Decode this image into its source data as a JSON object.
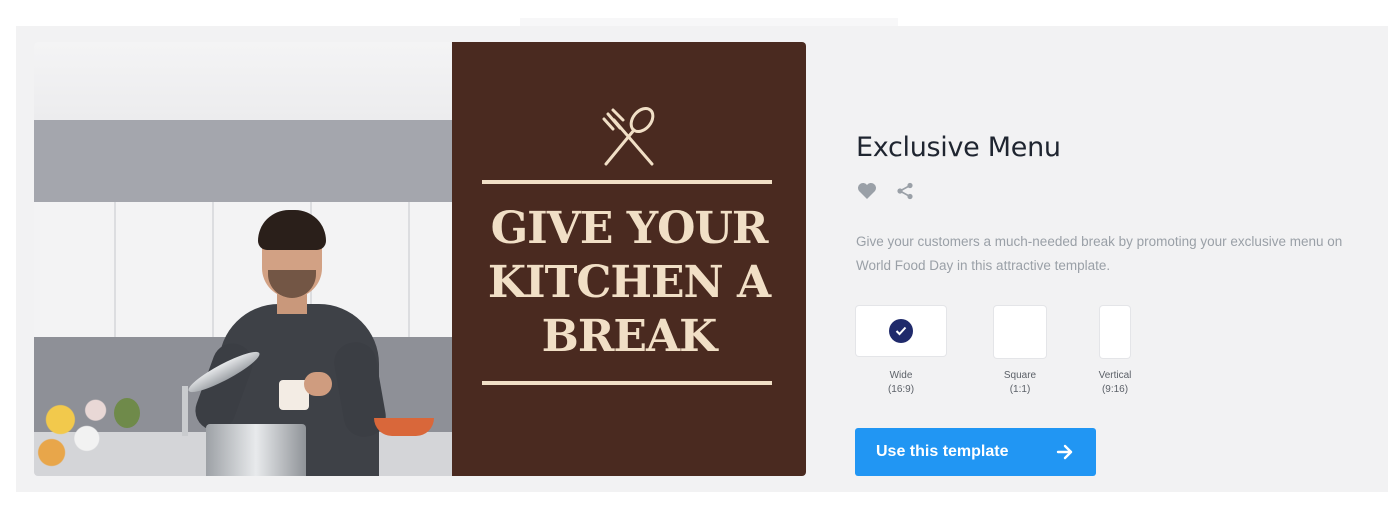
{
  "template": {
    "title": "Exclusive Menu",
    "description": "Give your customers a much-needed break by promoting your exclusive menu on World Food Day in this attractive template.",
    "actions": {
      "like_icon": "heart-icon",
      "share_icon": "share-icon"
    },
    "preview": {
      "headline": "GIVE YOUR KITCHEN A BREAK",
      "icon": "fork-spoon-icon",
      "panel_color": "#4a2a20",
      "text_color": "#f1dfc6"
    },
    "formats": [
      {
        "name": "Wide",
        "ratio": "(16:9)",
        "selected": true
      },
      {
        "name": "Square",
        "ratio": "(1:1)",
        "selected": false
      },
      {
        "name": "Vertical",
        "ratio": "(9:16)",
        "selected": false
      }
    ],
    "cta": {
      "label": "Use this template",
      "icon": "arrow-right-icon",
      "color": "#2196f3"
    }
  }
}
